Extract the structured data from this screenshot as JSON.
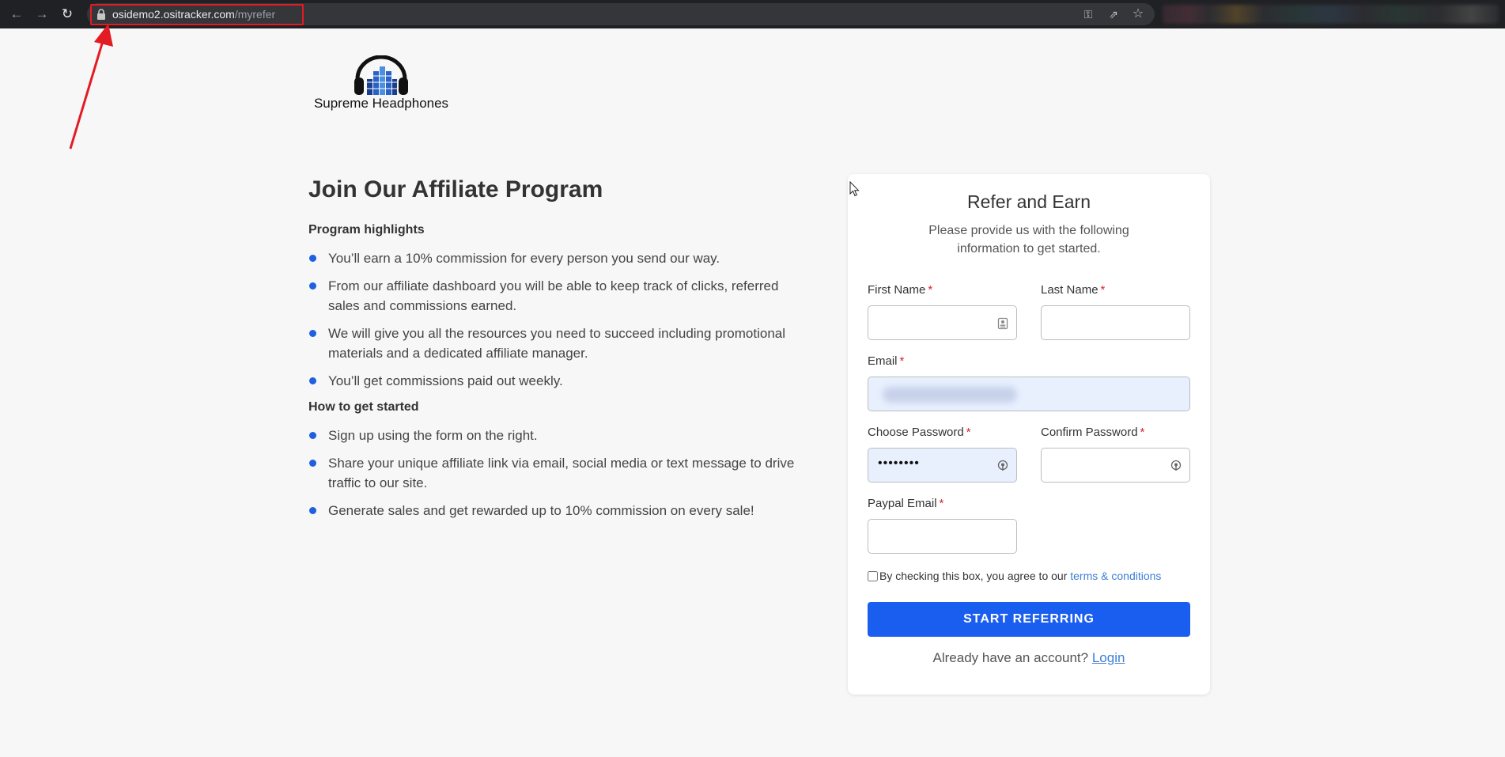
{
  "browser": {
    "url_host": "osidemo2.ositracker.com",
    "url_path": "/myrefer"
  },
  "brand": {
    "name": "Supreme Headphones"
  },
  "program": {
    "title": "Join Our Affiliate Program",
    "highlights_heading": "Program highlights",
    "highlights": [
      "You’ll earn a 10% commission for every person you send our way.",
      "From our affiliate dashboard you will be able to keep track of clicks, referred sales and commissions earned.",
      "We will give you all the resources you need to succeed including promotional materials and a dedicated affiliate manager.",
      "You’ll get commissions paid out weekly."
    ],
    "steps_heading": "How to get started",
    "steps": [
      "Sign up using the form on the right.",
      "Share your unique affiliate link via email, social media or text message to drive traffic to our site.",
      "Generate sales and get rewarded up to 10% commission on every sale!"
    ]
  },
  "form": {
    "title": "Refer and Earn",
    "subtitle": "Please provide us with the following information to get started.",
    "required_mark": "*",
    "first_name_label": "First Name",
    "last_name_label": "Last Name",
    "email_label": "Email",
    "password_label": "Choose Password",
    "confirm_password_label": "Confirm Password",
    "paypal_label": "Paypal Email",
    "password_value": "••••••••",
    "terms_text": "By checking this box, you agree to our ",
    "terms_link": "terms & conditions",
    "submit_label": "START REFERRING",
    "login_text": "Already have an account? ",
    "login_link": "Login"
  },
  "colors": {
    "accent": "#1a5ef0",
    "bullet": "#1f5fe0",
    "required": "#d9232e",
    "link": "#3d7fd6",
    "annotation": "#e31b23",
    "autofill": "#e8f0fe"
  }
}
